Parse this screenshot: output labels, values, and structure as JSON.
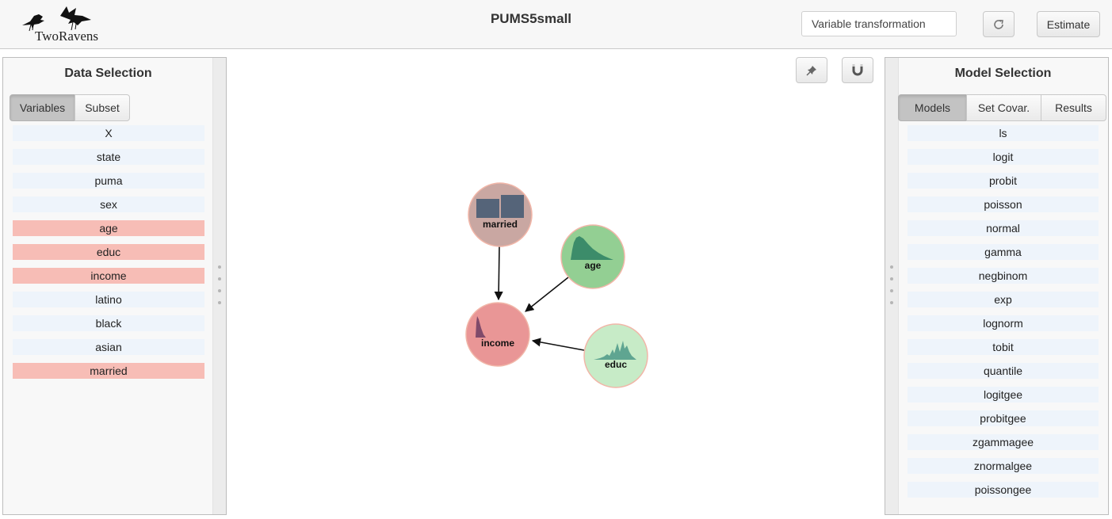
{
  "app": {
    "title": "PUMS5small",
    "logo_text": "TwoRavens"
  },
  "header": {
    "transform_placeholder": "Variable transformation",
    "estimate_label": "Estimate",
    "reset_icon": "refresh-icon"
  },
  "left_panel": {
    "title": "Data Selection",
    "tabs": [
      {
        "label": "Variables",
        "active": true
      },
      {
        "label": "Subset",
        "active": false
      }
    ],
    "variables": [
      {
        "label": "X",
        "selected": false
      },
      {
        "label": "state",
        "selected": false
      },
      {
        "label": "puma",
        "selected": false
      },
      {
        "label": "sex",
        "selected": false
      },
      {
        "label": "age",
        "selected": true
      },
      {
        "label": "educ",
        "selected": true
      },
      {
        "label": "income",
        "selected": true
      },
      {
        "label": "latino",
        "selected": false
      },
      {
        "label": "black",
        "selected": false
      },
      {
        "label": "asian",
        "selected": false
      },
      {
        "label": "married",
        "selected": true
      }
    ]
  },
  "right_panel": {
    "title": "Model Selection",
    "tabs": [
      {
        "label": "Models",
        "active": true
      },
      {
        "label": "Set Covar.",
        "active": false
      },
      {
        "label": "Results",
        "active": false
      }
    ],
    "models": [
      "ls",
      "logit",
      "probit",
      "poisson",
      "normal",
      "gamma",
      "negbinom",
      "exp",
      "lognorm",
      "tobit",
      "quantile",
      "logitgee",
      "probitgee",
      "zgammagee",
      "znormalgee",
      "poissongee"
    ]
  },
  "canvas": {
    "tools": [
      "pin-icon",
      "magnet-icon"
    ],
    "nodes": [
      {
        "id": "married",
        "label": "married",
        "fill": "#c9a7a2",
        "plot": "bars"
      },
      {
        "id": "age",
        "label": "age",
        "fill": "#93cf93",
        "plot": "density"
      },
      {
        "id": "income",
        "label": "income",
        "fill": "#e99696",
        "plot": "spike"
      },
      {
        "id": "educ",
        "label": "educ",
        "fill": "#c7ebc7",
        "plot": "multimodal"
      }
    ],
    "edges": [
      {
        "from": "married",
        "to": "income"
      },
      {
        "from": "age",
        "to": "income"
      },
      {
        "from": "educ",
        "to": "income"
      }
    ]
  },
  "colors": {
    "selected_variable": "#f7bdb6",
    "unselected_variable": "#eef4fb",
    "dependent_node": "#e99696",
    "covariate_node": "#93cf93",
    "node_stroke": "#f1b6a8",
    "bar_fill": "#556479",
    "density_fill": "#3c8c6a",
    "spike_fill": "#7f4a6a"
  }
}
